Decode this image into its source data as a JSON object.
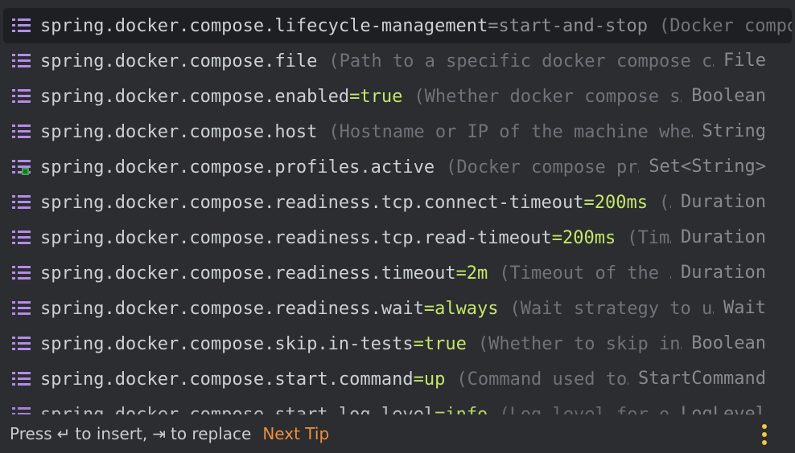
{
  "rows": [
    {
      "name": "spring.docker.compose.lifecycle-management",
      "value": "=start-and-stop",
      "desc": "(Docker compos",
      "type": ""
    },
    {
      "name": "spring.docker.compose.file",
      "value": "",
      "desc": "(Path to a specific docker compose c…",
      "type": "File"
    },
    {
      "name": "spring.docker.compose.enabled",
      "value": "=true",
      "desc": "(Whether docker compose s…",
      "type": "Boolean"
    },
    {
      "name": "spring.docker.compose.host",
      "value": "",
      "desc": "(Hostname or IP of the machine whe…",
      "type": "String"
    },
    {
      "name": "spring.docker.compose.profiles.active",
      "value": "",
      "desc": "(Docker compose pr…",
      "type": "Set<String>"
    },
    {
      "name": "spring.docker.compose.readiness.tcp.connect-timeout",
      "value": "=200ms",
      "desc": "(…",
      "type": "Duration"
    },
    {
      "name": "spring.docker.compose.readiness.tcp.read-timeout",
      "value": "=200ms",
      "desc": "(Tim…",
      "type": "Duration"
    },
    {
      "name": "spring.docker.compose.readiness.timeout",
      "value": "=2m",
      "desc": "(Timeout of the …",
      "type": "Duration"
    },
    {
      "name": "spring.docker.compose.readiness.wait",
      "value": "=always",
      "desc": "(Wait strategy to u…",
      "type": "Wait"
    },
    {
      "name": "spring.docker.compose.skip.in-tests",
      "value": "=true",
      "desc": "(Whether to skip in…",
      "type": "Boolean"
    },
    {
      "name": "spring.docker.compose.start.command",
      "value": "=up",
      "desc": "(Command used to…",
      "type": "StartCommand"
    },
    {
      "name": "spring.docker.compose.start.log-level",
      "value": "=info",
      "desc": "(Log level for o…",
      "type": "LogLevel"
    }
  ],
  "footer": {
    "press": "Press",
    "enter_glyph": "↵",
    "to_insert": "to insert,",
    "tab_glyph": "⇥",
    "to_replace": "to replace",
    "next_tip": "Next Tip"
  },
  "colors": {
    "icon": "#b48bea",
    "value": "#c6e66b",
    "accent": "#f08e3d",
    "kebab": "#f5c542"
  }
}
